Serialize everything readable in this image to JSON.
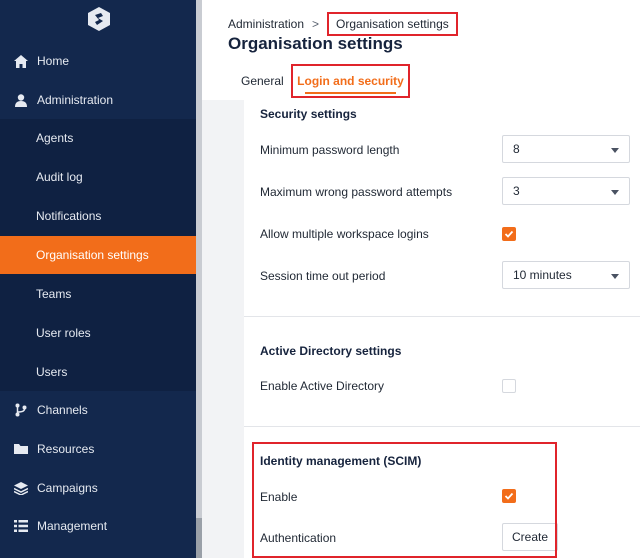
{
  "sidebar": {
    "logo": "logo-icon",
    "items": [
      {
        "label": "Home",
        "icon": "home-icon"
      },
      {
        "label": "Administration",
        "icon": "user-icon"
      },
      {
        "label": "Channels",
        "icon": "branch-icon"
      },
      {
        "label": "Resources",
        "icon": "folder-icon"
      },
      {
        "label": "Campaigns",
        "icon": "layers-icon"
      },
      {
        "label": "Management",
        "icon": "list-icon"
      }
    ],
    "subitems": [
      "Agents",
      "Audit log",
      "Notifications",
      "Organisation settings",
      "Teams",
      "User roles",
      "Users"
    ],
    "active_sub": "Organisation settings"
  },
  "breadcrumb": {
    "parent": "Administration",
    "separator": ">",
    "current": "Organisation settings"
  },
  "page": {
    "title": "Organisation settings",
    "tabs": [
      "General",
      "Login and security"
    ],
    "active_tab": "Login and security"
  },
  "security": {
    "title": "Security settings",
    "min_password_label": "Minimum password length",
    "min_password_value": "8",
    "max_attempts_label": "Maximum wrong password attempts",
    "max_attempts_value": "3",
    "multi_login_label": "Allow multiple workspace logins",
    "multi_login_checked": true,
    "timeout_label": "Session time out period",
    "timeout_value": "10 minutes"
  },
  "active_directory": {
    "title": "Active Directory settings",
    "enable_label": "Enable Active Directory",
    "enable_checked": false
  },
  "scim": {
    "title": "Identity management (SCIM)",
    "enable_label": "Enable",
    "enable_checked": true,
    "auth_label": "Authentication",
    "create_label": "Create"
  },
  "colors": {
    "sidebar_bg": "#13284d",
    "accent": "#f26d1a",
    "highlight_border": "#e0242b"
  }
}
